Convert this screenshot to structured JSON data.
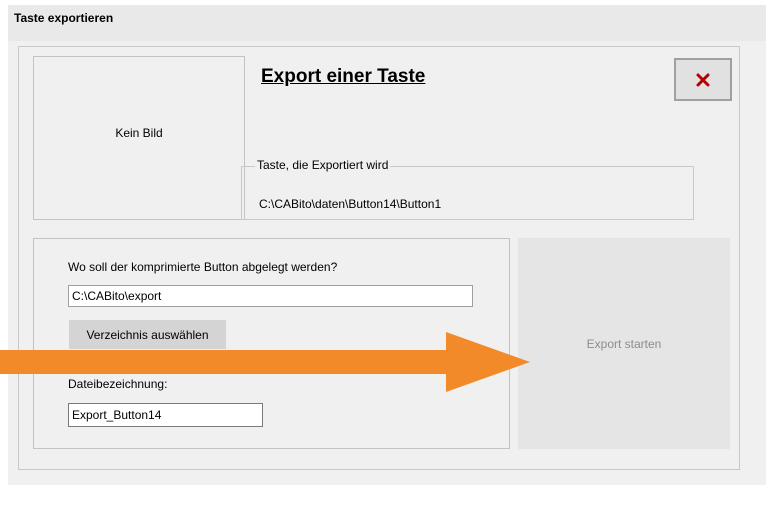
{
  "window": {
    "title": "Taste exportieren"
  },
  "preview": {
    "placeholder": "Kein Bild"
  },
  "heading": "Export einer Taste",
  "close_button": {
    "icon": "close-x-icon",
    "color": "#b00000"
  },
  "key_group": {
    "legend": "Taste, die Exportiert wird",
    "path": "C:\\CABito\\daten\\Button14\\Button1"
  },
  "target": {
    "label": "Wo soll der komprimierte Button abgelegt werden?",
    "directory_value": "C:\\CABito\\export",
    "choose_dir_label": "Verzeichnis auswählen",
    "filename_label": "Dateibezeichnung:",
    "filename_value": "Export_Button14"
  },
  "export_button": {
    "label": "Export starten"
  },
  "annotation": {
    "icon": "arrow-right-icon",
    "color": "#f28a2a"
  }
}
